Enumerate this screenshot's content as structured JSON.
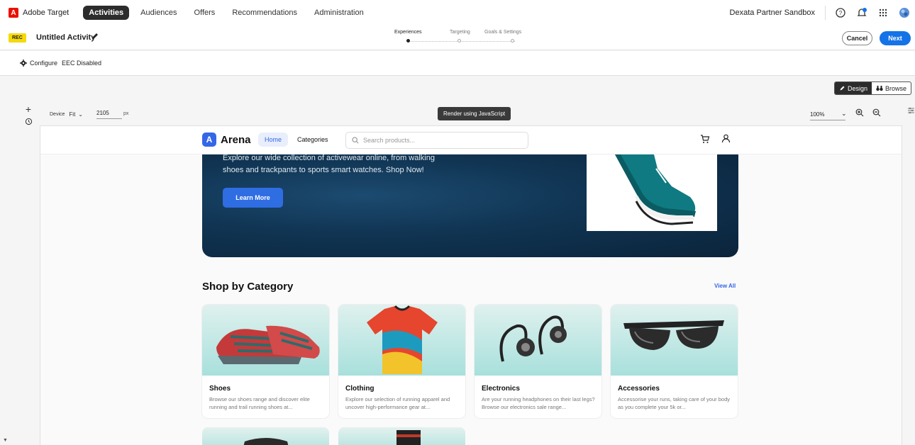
{
  "topnav": {
    "logo": "A",
    "app_name": "Adobe Target",
    "items": [
      "Activities",
      "Audiences",
      "Offers",
      "Recommendations",
      "Administration"
    ],
    "sandbox": "Dexata Partner Sandbox"
  },
  "activity": {
    "badge": "REC",
    "title": "Untitled Activity",
    "steps": [
      "Experiences",
      "Targeting",
      "Goals & Settings"
    ],
    "cancel_label": "Cancel",
    "next_label": "Next"
  },
  "config": {
    "configure_label": "Configure",
    "eec_label": "EEC Disabled"
  },
  "mode": {
    "design_label": "Design",
    "browse_label": "Browse"
  },
  "device": {
    "device_label": "Device",
    "fit_label": "Fit",
    "width": "2105",
    "unit": "px",
    "render_label": "Render using JavaScript",
    "zoom": "100%"
  },
  "site": {
    "brand_logo": "A",
    "brand_name": "Arena",
    "nav_home": "Home",
    "nav_categories": "Categories",
    "search_placeholder": "Search products...",
    "hero_text": "Explore our wide collection of activewear online, from walking shoes and trackpants to sports smart watches. Shop Now!",
    "learn_more": "Learn More",
    "section_title": "Shop by Category",
    "view_all": "View All",
    "categories": [
      {
        "title": "Shoes",
        "desc": "Browse our shoes range and discover elite running and trail running shoes at..."
      },
      {
        "title": "Clothing",
        "desc": "Explore our selection of running apparel and uncover high-performance gear at..."
      },
      {
        "title": "Electronics",
        "desc": "Are your running headphones on their last legs? Browse our electronics sale range..."
      },
      {
        "title": "Accessories",
        "desc": "Accessorise your runs, taking care of your body as you complete your 5k or..."
      }
    ]
  },
  "colors": {
    "accent": "#1473e6",
    "brand": "#3466e8",
    "hero": "#103452",
    "badge": "#f5d90a"
  }
}
